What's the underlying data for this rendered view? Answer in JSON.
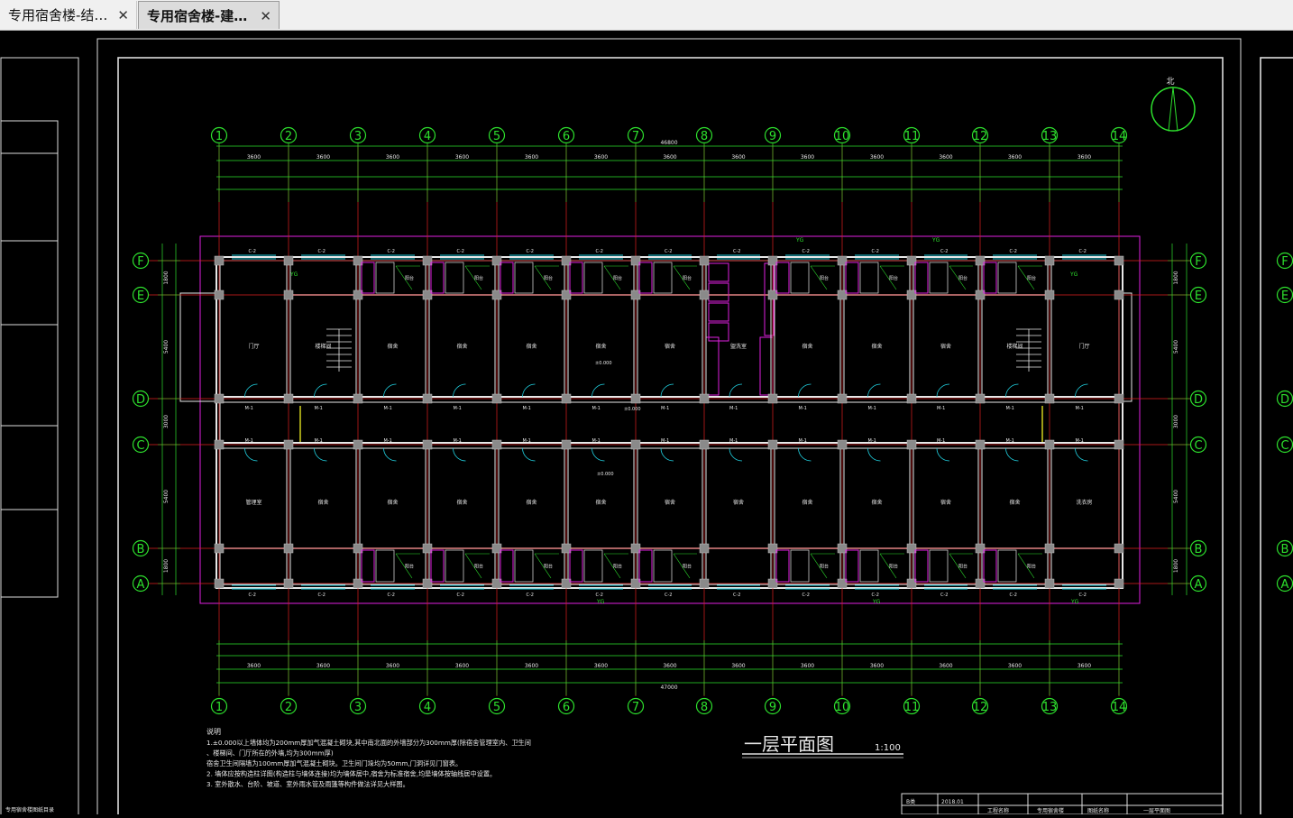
{
  "tabs": [
    {
      "label": "专用宿舍楼-结…",
      "active": false,
      "close": "✕"
    },
    {
      "label": "专用宿舍楼-建…",
      "active": true,
      "close": "✕"
    }
  ],
  "drawing": {
    "compass_label": "北",
    "axes_cols": [
      "1",
      "2",
      "3",
      "4",
      "5",
      "6",
      "7",
      "8",
      "9",
      "10",
      "11",
      "12",
      "13",
      "14"
    ],
    "axes_rows": [
      "F",
      "E",
      "D",
      "C",
      "B",
      "A"
    ],
    "total_dim_top": "46800",
    "total_dim_bottom": "47000",
    "bay_dim": "3600",
    "grid_dims": [
      "3600",
      "3600",
      "3600",
      "3600",
      "3600",
      "3600",
      "3600",
      "3600",
      "3600",
      "3600",
      "3600",
      "3600",
      "3600"
    ],
    "side_dims": [
      "1800",
      "5400",
      "3000",
      "5400",
      "1800"
    ],
    "title": "一层平面图",
    "scale": "1:100",
    "notes_title": "说明",
    "notes": [
      "1.±0.000以上墙体均为200mm厚加气混凝土砌块,其中南北面的外墙部分为300mm厚(除宿舍管理室内、卫生间",
      "  、楼梯间、门厅所在的外墙,均为300mm厚)",
      "宿舍卫生间隔墙为100mm厚加气混凝土砌块。卫生间门垛均为50mm,门洞详见门窗表。",
      "2. 墙体应按构造柱详图(构造柱与墙体连接)均为墙体居中,宿舍为标准宿舍,均是墙体按轴线居中设置。",
      "3. 室外散水、台阶、坡道、室外雨水管及雨篷等构件做法详见大样图。"
    ],
    "room_labels": [
      "门厅",
      "楼梯间",
      "宿舍",
      "宿舍",
      "宿舍",
      "宿舍",
      "宿舍",
      "盥洗室",
      "宿舍",
      "宿舍",
      "宿舍",
      "楼梯间",
      "门厅"
    ],
    "room_labels_south": [
      "管理室",
      "宿舍",
      "宿舍",
      "宿舍",
      "宿舍",
      "宿舍",
      "宿舍",
      "宿舍",
      "宿舍",
      "宿舍",
      "宿舍",
      "宿舍",
      "洗衣房"
    ],
    "title_block": [
      "B类",
      "2018.01",
      "工程名称",
      "专用宿舍楼",
      "图纸名称",
      "一层平面图"
    ],
    "left_panel_label": "专用宿舍楼图纸目录",
    "door_label": "M-1",
    "window_label": "C-2",
    "balcony_label": "YG",
    "level_label": "±0.000"
  }
}
